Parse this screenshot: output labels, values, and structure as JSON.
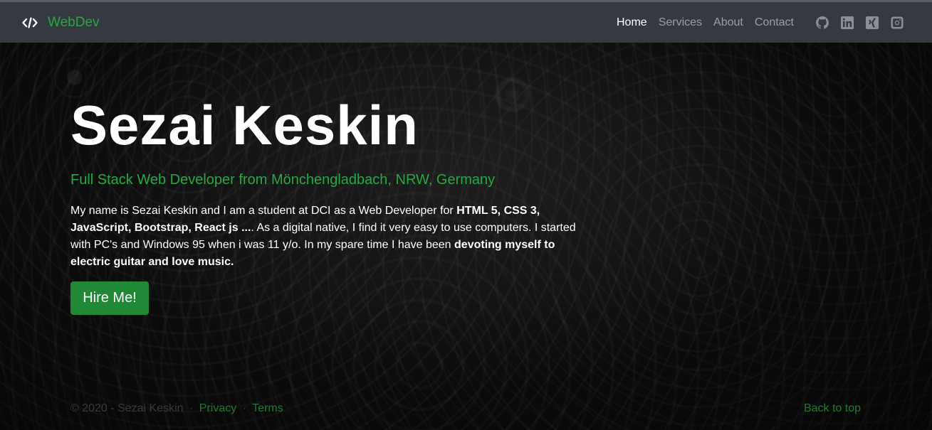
{
  "navbar": {
    "brand_icon": "code-icon",
    "brand": "WebDev",
    "links": [
      {
        "label": "Home",
        "active": true
      },
      {
        "label": "Services",
        "active": false
      },
      {
        "label": "About",
        "active": false
      },
      {
        "label": "Contact",
        "active": false
      }
    ],
    "social_icons": [
      "github-icon",
      "linkedin-icon",
      "xing-icon",
      "instagram-icon"
    ]
  },
  "hero": {
    "title": "Sezai Keskin",
    "subtitle": "Full Stack Web Developer from Mönchengladbach, NRW, Germany",
    "text_1": "My name is Sezai Keskin and I am a student at DCI as a Web Developer for ",
    "text_bold_1": "HTML 5, CSS 3, JavaScript, Bootstrap, React js ...",
    "text_2": ". As a digital native, I find it very easy to use computers. I started with PC's and Windows 95 when i was 11 y/o. In my spare time I have been ",
    "text_bold_2": "devoting myself to electric guitar and love music.",
    "button": "Hire Me!"
  },
  "footer": {
    "copyright": "© 2020 - Sezai Keskin",
    "separator": "·",
    "privacy": "Privacy",
    "terms": "Terms",
    "back_to_top": "Back to top"
  },
  "colors": {
    "accent": "#28a745",
    "navbar_bg": "#343a40"
  }
}
